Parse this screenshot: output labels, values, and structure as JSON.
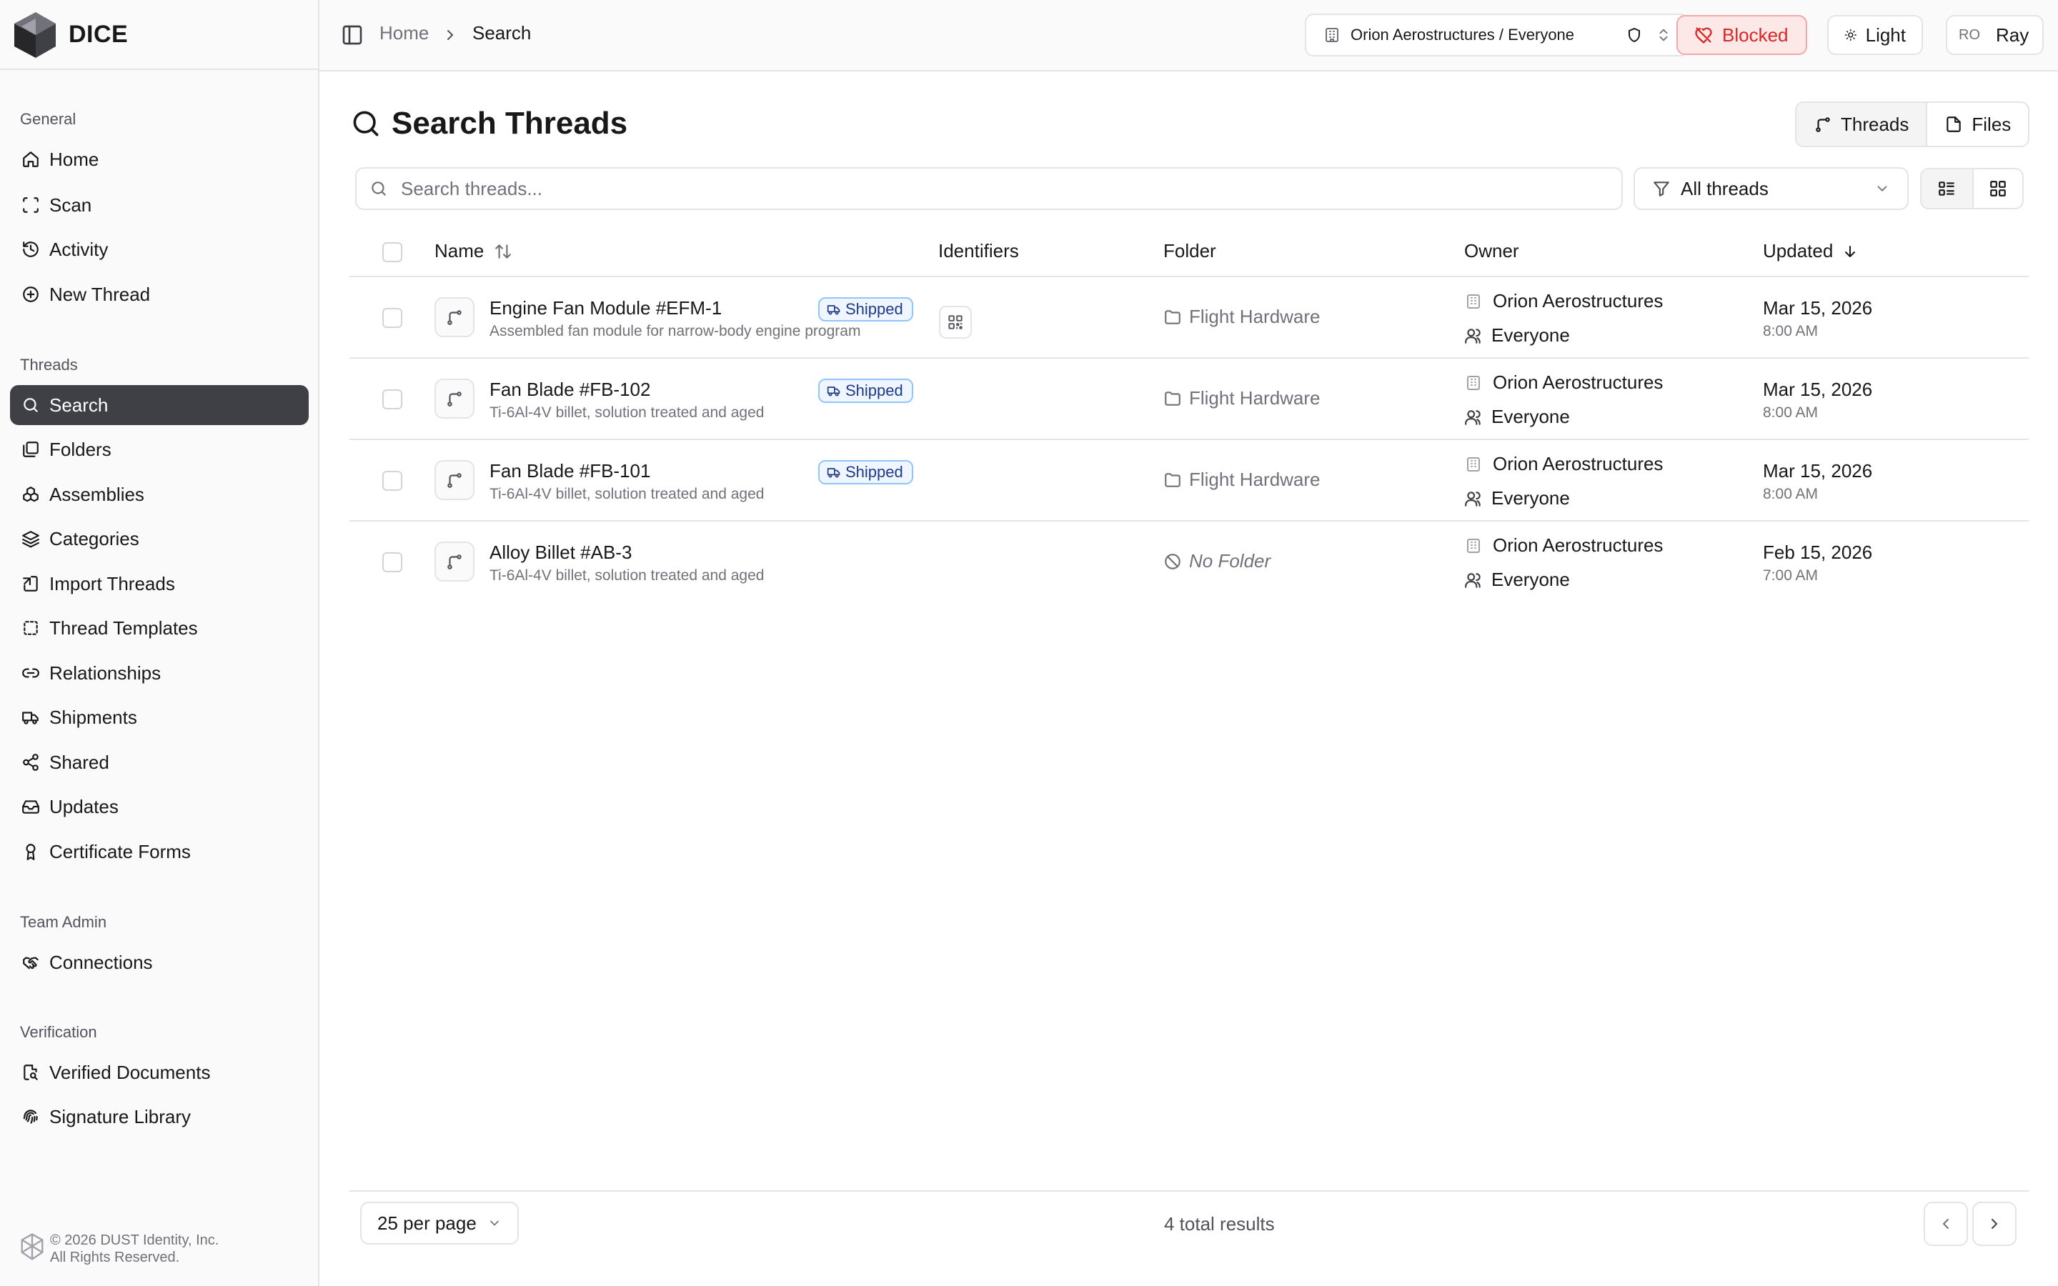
{
  "brand": {
    "name": "DICE"
  },
  "sidebar": {
    "groups": [
      {
        "label": "General",
        "items": [
          {
            "label": "Home",
            "icon": "home-icon"
          },
          {
            "label": "Scan",
            "icon": "scan-icon"
          },
          {
            "label": "Activity",
            "icon": "history-icon"
          },
          {
            "label": "New Thread",
            "icon": "plus-circle-icon"
          }
        ]
      },
      {
        "label": "Threads",
        "items": [
          {
            "label": "Search",
            "icon": "search-icon",
            "active": true
          },
          {
            "label": "Folders",
            "icon": "folders-icon"
          },
          {
            "label": "Assemblies",
            "icon": "boxes-icon"
          },
          {
            "label": "Categories",
            "icon": "layers-icon"
          },
          {
            "label": "Import Threads",
            "icon": "import-icon"
          },
          {
            "label": "Thread Templates",
            "icon": "template-icon"
          },
          {
            "label": "Relationships",
            "icon": "link-icon"
          },
          {
            "label": "Shipments",
            "icon": "truck-icon"
          },
          {
            "label": "Shared",
            "icon": "share-icon"
          },
          {
            "label": "Updates",
            "icon": "inbox-icon"
          },
          {
            "label": "Certificate Forms",
            "icon": "award-icon"
          }
        ]
      },
      {
        "label": "Team Admin",
        "items": [
          {
            "label": "Connections",
            "icon": "handshake-icon"
          }
        ]
      },
      {
        "label": "Verification",
        "items": [
          {
            "label": "Verified Documents",
            "icon": "file-check-icon"
          },
          {
            "label": "Signature Library",
            "icon": "fingerprint-icon"
          }
        ]
      }
    ],
    "footer": {
      "line1": "© 2026 DUST Identity, Inc.",
      "line2": "All Rights Reserved."
    }
  },
  "header": {
    "breadcrumb": {
      "home": "Home",
      "current": "Search"
    },
    "org_select": "Orion Aerostructures / Everyone",
    "blocked_label": "Blocked",
    "theme_label": "Light",
    "user": {
      "initials": "RO",
      "name": "Ray"
    }
  },
  "page": {
    "title": "Search Threads",
    "tabs": {
      "threads": "Threads",
      "files": "Files"
    },
    "search_placeholder": "Search threads...",
    "filter": "All threads"
  },
  "table": {
    "columns": {
      "name": "Name",
      "identifiers": "Identifiers",
      "folder": "Folder",
      "owner": "Owner",
      "updated": "Updated"
    },
    "rows": [
      {
        "name": "Engine Fan Module #EFM-1",
        "desc": "Assembled fan module for narrow-body engine program",
        "badge": "Shipped",
        "has_qr": true,
        "folder": "Flight Hardware",
        "owner_org": "Orion Aerostructures",
        "owner_team": "Everyone",
        "date": "Mar 15, 2026",
        "time": "8:00 AM"
      },
      {
        "name": "Fan Blade #FB-102",
        "desc": "Ti-6Al-4V billet, solution treated and aged",
        "badge": "Shipped",
        "has_qr": false,
        "folder": "Flight Hardware",
        "owner_org": "Orion Aerostructures",
        "owner_team": "Everyone",
        "date": "Mar 15, 2026",
        "time": "8:00 AM"
      },
      {
        "name": "Fan Blade #FB-101",
        "desc": "Ti-6Al-4V billet, solution treated and aged",
        "badge": "Shipped",
        "has_qr": false,
        "folder": "Flight Hardware",
        "owner_org": "Orion Aerostructures",
        "owner_team": "Everyone",
        "date": "Mar 15, 2026",
        "time": "8:00 AM"
      },
      {
        "name": "Alloy Billet #AB-3",
        "desc": "Ti-6Al-4V billet, solution treated and aged",
        "badge": "",
        "has_qr": false,
        "folder": "No Folder",
        "owner_org": "Orion Aerostructures",
        "owner_team": "Everyone",
        "date": "Feb 15, 2026",
        "time": "7:00 AM"
      }
    ]
  },
  "pagination": {
    "per_page": "25 per page",
    "total": "4 total results"
  },
  "colors": {
    "accent": "#3f3f46",
    "blocked": "#dc2626",
    "badge_border": "#93c5fd",
    "border": "#e4e4e7"
  }
}
